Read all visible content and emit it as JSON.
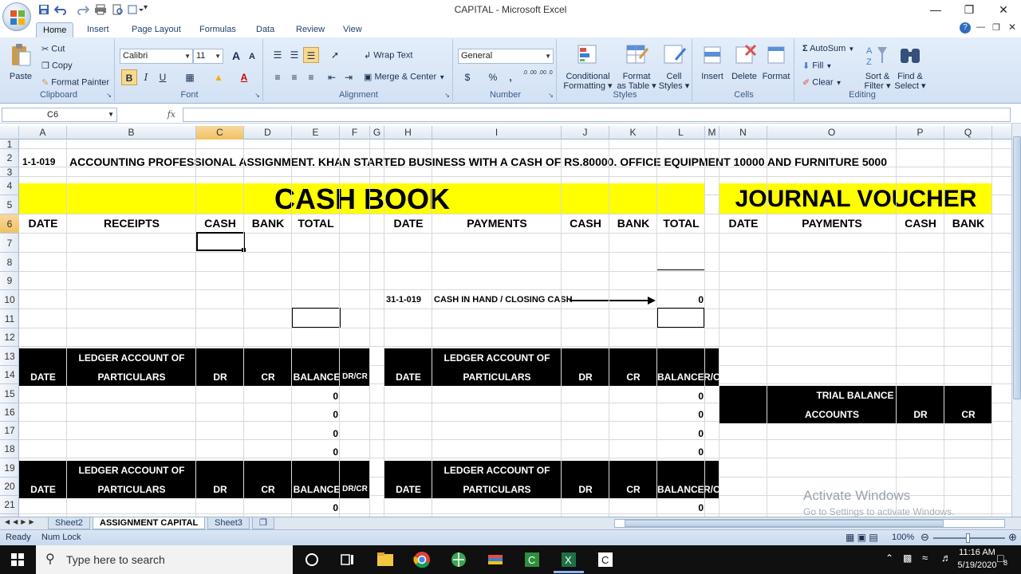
{
  "window": {
    "title": "CAPITAL - Microsoft Excel",
    "qat_more": "▾"
  },
  "tabs": [
    "Home",
    "Insert",
    "Page Layout",
    "Formulas",
    "Data",
    "Review",
    "View"
  ],
  "ribbon": {
    "clipboard": {
      "label": "Clipboard",
      "paste": "Paste",
      "cut": "Cut",
      "copy": "Copy",
      "format_painter": "Format Painter"
    },
    "font": {
      "label": "Font",
      "name": "Calibri",
      "size": "11",
      "grow": "A",
      "shrink": "A",
      "bold": "B",
      "italic": "I",
      "underline": "U"
    },
    "alignment": {
      "label": "Alignment",
      "wrap": "Wrap Text",
      "merge": "Merge & Center"
    },
    "number": {
      "label": "Number",
      "format": "General",
      "currency": "$",
      "percent": "%",
      "comma": ",",
      "inc_dec": ".0 .00",
      "dec_dec": ".00 .0"
    },
    "styles": {
      "label": "Styles",
      "cond": [
        "Conditional",
        "Formatting ▾"
      ],
      "table": [
        "Format",
        "as Table ▾"
      ],
      "cell": [
        "Cell",
        "Styles ▾"
      ]
    },
    "cells": {
      "label": "Cells",
      "insert": "Insert",
      "delete": "Delete",
      "format": "Format"
    },
    "editing": {
      "label": "Editing",
      "autosum": "AutoSum",
      "fill": "Fill",
      "clear": "Clear",
      "sort": [
        "Sort &",
        "Filter ▾"
      ],
      "find": [
        "Find &",
        "Select ▾"
      ]
    }
  },
  "formula_bar": {
    "name_box": "C6",
    "fx": "fx",
    "value": ""
  },
  "columns": [
    "A",
    "B",
    "C",
    "D",
    "E",
    "F",
    "G",
    "H",
    "I",
    "J",
    "K",
    "L",
    "M",
    "N",
    "O",
    "P",
    "Q"
  ],
  "rows": [
    "1",
    "2",
    "3",
    "4",
    "5",
    "6",
    "7",
    "8",
    "9",
    "10",
    "11",
    "12",
    "13",
    "14",
    "15",
    "16",
    "17",
    "18",
    "19",
    "20",
    "21"
  ],
  "sheet": {
    "r1_a": "1-1-019",
    "r1_text": "ACCOUNTING PROFESSIONAL ASSIGNMENT.  KHAN STARTED BUSINESS WITH A CASH OF RS.80000. OFFICE EQUIPMENT 10000 AND FURNITURE 5000",
    "cash_book": "CASH BOOK",
    "journal": "JOURNAL VOUCHER",
    "cb_headers": [
      "DATE",
      "RECEIPTS",
      "CASH",
      "BANK",
      "TOTAL"
    ],
    "pay_headers": [
      "DATE",
      "PAYMENTS",
      "CASH",
      "BANK",
      "TOTAL"
    ],
    "jv_headers": [
      "DATE",
      "PAYMENTS",
      "CASH",
      "BANK"
    ],
    "r9_date": "31-1-019",
    "r9_text": "CASH IN HAND / CLOSING CASH",
    "r9_total": "0",
    "ledger_title": "LEDGER ACCOUNT OF",
    "ledger_cols_left": [
      "DATE",
      "PARTICULARS",
      "DR",
      "CR",
      "BALANCE",
      "DR/CR"
    ],
    "ledger_cols_right": [
      "DATE",
      "PARTICULARS",
      "DR",
      "CR",
      "BALANCE",
      "R/C"
    ],
    "zero": "0",
    "trial_title": "TRIAL BALANCE",
    "trial_cols": [
      "ACCOUNTS",
      "DR",
      "CR"
    ]
  },
  "sheet_tabs": [
    "Sheet2",
    "ASSIGNMENT CAPITAL",
    "Sheet3"
  ],
  "status": {
    "ready": "Ready",
    "numlock": "Num Lock",
    "zoom": "100%"
  },
  "watermark": {
    "line1": "Activate Windows",
    "line2": "Go to Settings to activate Windows."
  },
  "taskbar": {
    "search_placeholder": "Type here to search",
    "time": "11:16 AM",
    "date": "5/19/2020",
    "notif_count": "8"
  }
}
